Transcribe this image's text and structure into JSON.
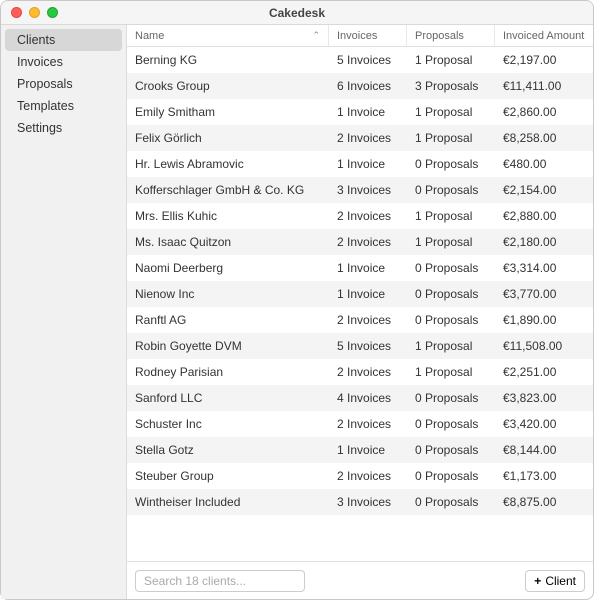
{
  "window": {
    "title": "Cakedesk"
  },
  "sidebar": {
    "items": [
      {
        "label": "Clients",
        "active": true
      },
      {
        "label": "Invoices",
        "active": false
      },
      {
        "label": "Proposals",
        "active": false
      },
      {
        "label": "Templates",
        "active": false
      },
      {
        "label": "Settings",
        "active": false
      }
    ]
  },
  "table": {
    "columns": {
      "name": "Name",
      "invoices": "Invoices",
      "proposals": "Proposals",
      "amount": "Invoiced Amount"
    },
    "sort_caret": "⌃",
    "rows": [
      {
        "name": "Berning KG",
        "invoices": "5 Invoices",
        "proposals": "1 Proposal",
        "amount": "€2,197.00"
      },
      {
        "name": "Crooks Group",
        "invoices": "6 Invoices",
        "proposals": "3 Proposals",
        "amount": "€11,411.00"
      },
      {
        "name": "Emily Smitham",
        "invoices": "1 Invoice",
        "proposals": "1 Proposal",
        "amount": "€2,860.00"
      },
      {
        "name": "Felix Görlich",
        "invoices": "2 Invoices",
        "proposals": "1 Proposal",
        "amount": "€8,258.00"
      },
      {
        "name": "Hr. Lewis Abramovic",
        "invoices": "1 Invoice",
        "proposals": "0 Proposals",
        "amount": "€480.00"
      },
      {
        "name": "Kofferschlager GmbH & Co. KG",
        "invoices": "3 Invoices",
        "proposals": "0 Proposals",
        "amount": "€2,154.00"
      },
      {
        "name": "Mrs. Ellis Kuhic",
        "invoices": "2 Invoices",
        "proposals": "1 Proposal",
        "amount": "€2,880.00"
      },
      {
        "name": "Ms. Isaac Quitzon",
        "invoices": "2 Invoices",
        "proposals": "1 Proposal",
        "amount": "€2,180.00"
      },
      {
        "name": "Naomi Deerberg",
        "invoices": "1 Invoice",
        "proposals": "0 Proposals",
        "amount": "€3,314.00"
      },
      {
        "name": "Nienow Inc",
        "invoices": "1 Invoice",
        "proposals": "0 Proposals",
        "amount": "€3,770.00"
      },
      {
        "name": "Ranftl AG",
        "invoices": "2 Invoices",
        "proposals": "0 Proposals",
        "amount": "€1,890.00"
      },
      {
        "name": "Robin Goyette DVM",
        "invoices": "5 Invoices",
        "proposals": "1 Proposal",
        "amount": "€11,508.00"
      },
      {
        "name": "Rodney Parisian",
        "invoices": "2 Invoices",
        "proposals": "1 Proposal",
        "amount": "€2,251.00"
      },
      {
        "name": "Sanford LLC",
        "invoices": "4 Invoices",
        "proposals": "0 Proposals",
        "amount": "€3,823.00"
      },
      {
        "name": "Schuster Inc",
        "invoices": "2 Invoices",
        "proposals": "0 Proposals",
        "amount": "€3,420.00"
      },
      {
        "name": "Stella Gotz",
        "invoices": "1 Invoice",
        "proposals": "0 Proposals",
        "amount": "€8,144.00"
      },
      {
        "name": "Steuber Group",
        "invoices": "2 Invoices",
        "proposals": "0 Proposals",
        "amount": "€1,173.00"
      },
      {
        "name": "Wintheiser Included",
        "invoices": "3 Invoices",
        "proposals": "0 Proposals",
        "amount": "€8,875.00"
      }
    ]
  },
  "footer": {
    "search_placeholder": "Search 18 clients...",
    "add_label": "Client",
    "plus": "+"
  }
}
